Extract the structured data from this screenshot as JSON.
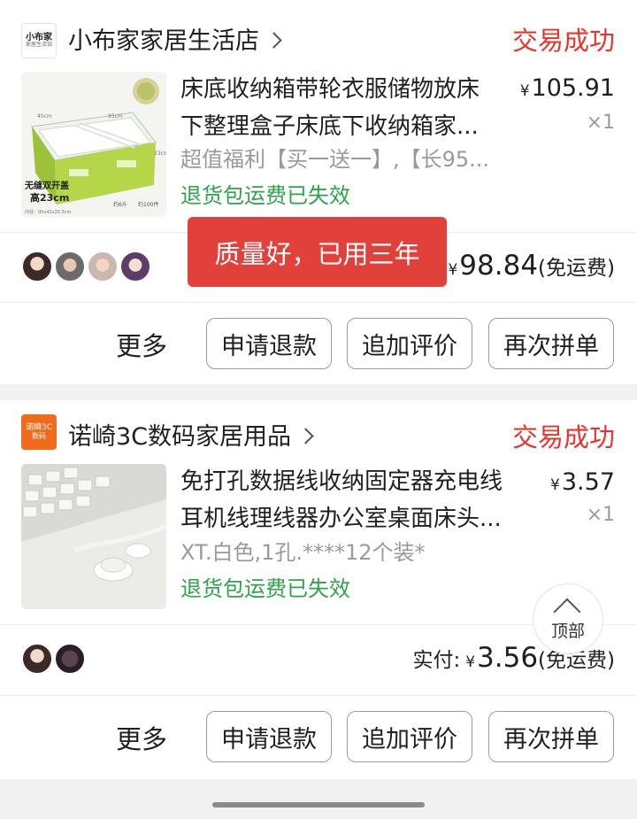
{
  "orders": [
    {
      "shop": {
        "logo_text_1": "小布家",
        "logo_text_2": "家居生活馆",
        "name": "小布家家居生活店",
        "status": "交易成功"
      },
      "product": {
        "title_line1": "床底收纳箱带轮衣服储物放床",
        "title_line2": "下整理盒子床底下收纳箱家...",
        "spec": "超值福利【买一送一】,【长95...",
        "policy": "退货包运费已失效",
        "price_symbol": "¥",
        "price": "105.91",
        "qty": "×1",
        "thumb_badge_1": "无缝双开盖",
        "thumb_badge_2": "高23cm",
        "thumb_dim_1": "45cm",
        "thumb_dim_2": "95cm",
        "thumb_dim_3": "23cm",
        "thumb_foot_1": "约6斤",
        "thumb_foot_2": "约100件",
        "thumb_foot_3": "内径：90x42x20.5cm"
      },
      "paid": {
        "label": "",
        "symbol": "¥",
        "amount": "98.84",
        "note": "(免运费)"
      },
      "actions": {
        "more": "更多",
        "refund": "申请退款",
        "review": "追加评价",
        "rebuy": "再次拼单"
      }
    },
    {
      "shop": {
        "logo_text_1": "诺崎3C",
        "logo_text_2": "数码",
        "name": "诺崎3C数码家居用品",
        "status": "交易成功"
      },
      "product": {
        "title_line1": "免打孔数据线收纳固定器充电线",
        "title_line2": "耳机线理线器办公室桌面床头...",
        "spec": "XT.白色,1孔.****12个装*",
        "policy": "退货包运费已失效",
        "price_symbol": "¥",
        "price": "3.57",
        "qty": "×1"
      },
      "paid": {
        "label": "实付:",
        "symbol": "¥",
        "amount": "3.56",
        "note": "(免运费)"
      },
      "actions": {
        "more": "更多",
        "refund": "申请退款",
        "review": "追加评价",
        "rebuy": "再次拼单"
      }
    }
  ],
  "toast": "质量好，已用三年",
  "back_to_top": "顶部",
  "colors": {
    "status_red": "#e5352d",
    "policy_green": "#2ea34a",
    "toast_red": "#e2403a"
  }
}
